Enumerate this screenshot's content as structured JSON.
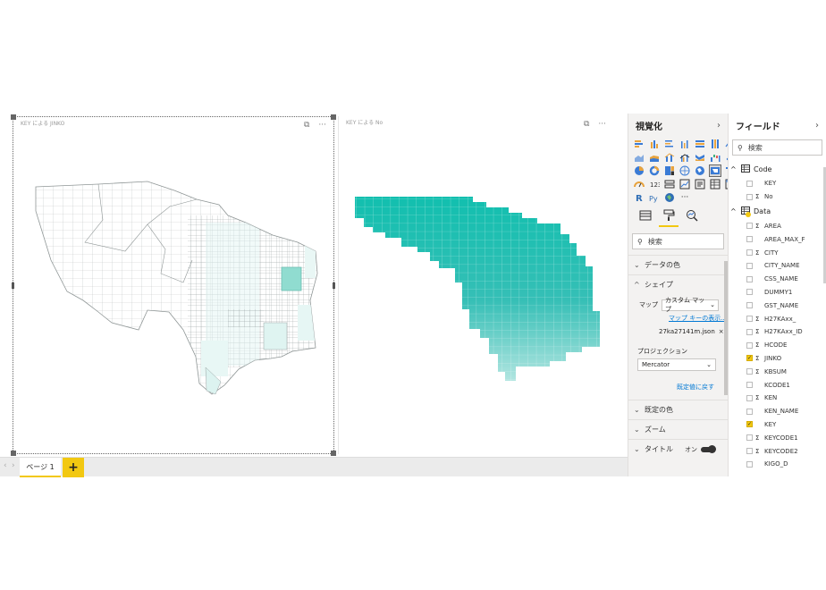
{
  "canvas": {
    "visual1_title": "KEY による JINKO",
    "visual2_title": "KEY による No",
    "focus_icon": "focus-mode-icon",
    "more_label": "···"
  },
  "pagebar": {
    "nav_prev": "‹",
    "nav_next": "›",
    "page_tab_label": "ページ 1",
    "add_label": "+"
  },
  "viz_pane": {
    "title": "視覚化",
    "collapse": "›",
    "search_placeholder": "検索",
    "more_visuals": "···",
    "sections": {
      "data_color": "データの色",
      "shape": "シェイプ",
      "default_color": "既定の色",
      "zoom": "ズーム",
      "title": "タイトル"
    },
    "map_label": "マップ",
    "map_value": "カスタム マップ",
    "map_keys_link": "マップ キーの表示...",
    "file_name": "27ka27141m.json",
    "file_remove": "×",
    "projection_label": "プロジェクション",
    "projection_value": "Mercator",
    "reset_label": "既定値に戻す",
    "toggle_on": "オン"
  },
  "fields_pane": {
    "title": "フィールド",
    "collapse": "›",
    "search_placeholder": "検索",
    "tables": [
      {
        "name": "Code",
        "fields": [
          {
            "name": "KEY",
            "sigma": false,
            "checked": false
          },
          {
            "name": "No",
            "sigma": true,
            "checked": false
          }
        ]
      },
      {
        "name": "Data",
        "fields": [
          {
            "name": "AREA",
            "sigma": true,
            "checked": false
          },
          {
            "name": "AREA_MAX_F",
            "sigma": false,
            "checked": false
          },
          {
            "name": "CITY",
            "sigma": true,
            "checked": false
          },
          {
            "name": "CITY_NAME",
            "sigma": false,
            "checked": false
          },
          {
            "name": "CSS_NAME",
            "sigma": false,
            "checked": false
          },
          {
            "name": "DUMMY1",
            "sigma": false,
            "checked": false
          },
          {
            "name": "GST_NAME",
            "sigma": false,
            "checked": false
          },
          {
            "name": "H27KAxx_",
            "sigma": true,
            "checked": false
          },
          {
            "name": "H27KAxx_ID",
            "sigma": true,
            "checked": false
          },
          {
            "name": "HCODE",
            "sigma": true,
            "checked": false
          },
          {
            "name": "JINKO",
            "sigma": true,
            "checked": true
          },
          {
            "name": "KBSUM",
            "sigma": true,
            "checked": false
          },
          {
            "name": "KCODE1",
            "sigma": false,
            "checked": false
          },
          {
            "name": "KEN",
            "sigma": true,
            "checked": false
          },
          {
            "name": "KEN_NAME",
            "sigma": false,
            "checked": false
          },
          {
            "name": "KEY",
            "sigma": false,
            "checked": true
          },
          {
            "name": "KEYCODE1",
            "sigma": true,
            "checked": false
          },
          {
            "name": "KEYCODE2",
            "sigma": true,
            "checked": false
          },
          {
            "name": "KIGO_D",
            "sigma": false,
            "checked": false
          }
        ]
      }
    ]
  },
  "colors": {
    "accent": "#f2c811",
    "teal": "#15b8ac",
    "link": "#0078d4"
  }
}
